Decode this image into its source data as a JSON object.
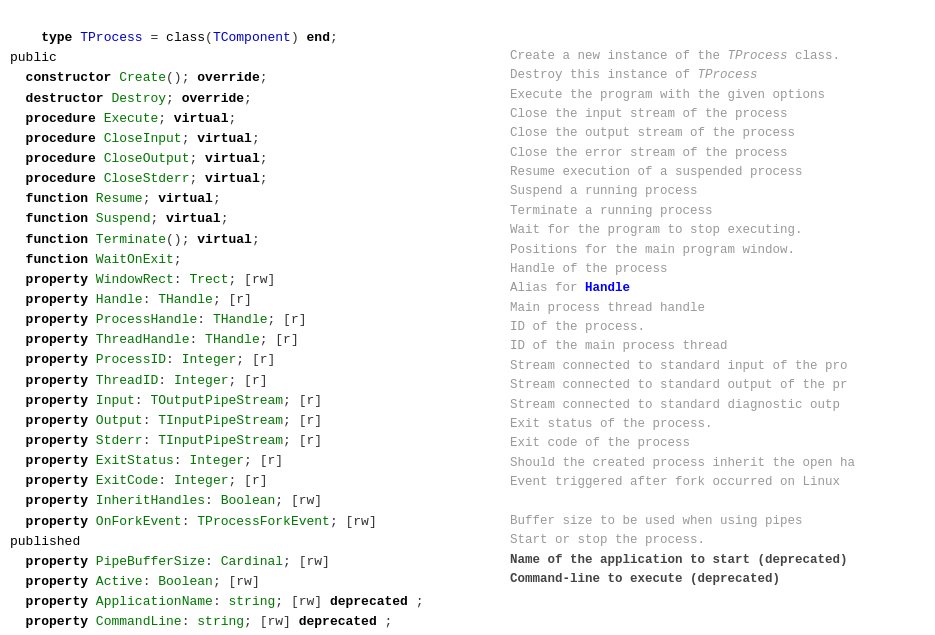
{
  "lines": [
    {
      "code": "type TProcess = class(TComponent) end;",
      "comment": ""
    },
    {
      "code": "public",
      "comment": ""
    },
    {
      "code": "  constructor Create(); override;",
      "comment": "Create a new instance of the TProcess class."
    },
    {
      "code": "  destructor Destroy; override;",
      "comment": "Destroy this instance of TProcess"
    },
    {
      "code": "  procedure Execute; virtual;",
      "comment": "Execute the program with the given options"
    },
    {
      "code": "  procedure CloseInput; virtual;",
      "comment": "Close the input stream of the process"
    },
    {
      "code": "  procedure CloseOutput; virtual;",
      "comment": "Close the output stream of the process"
    },
    {
      "code": "  procedure CloseStderr; virtual;",
      "comment": "Close the error stream of the process"
    },
    {
      "code": "  function Resume; virtual;",
      "comment": "Resume execution of a suspended process"
    },
    {
      "code": "  function Suspend; virtual;",
      "comment": "Suspend a running process"
    },
    {
      "code": "  function Terminate(); virtual;",
      "comment": "Terminate a running process"
    },
    {
      "code": "  function WaitOnExit;",
      "comment": "Wait for the program to stop executing."
    },
    {
      "code": "  property WindowRect: Trect; [rw]",
      "comment": "Positions for the main program window."
    },
    {
      "code": "  property Handle: THandle; [r]",
      "comment": "Handle of the process"
    },
    {
      "code": "  property ProcessHandle: THandle; [r]",
      "comment": "Alias for Handle"
    },
    {
      "code": "  property ThreadHandle: THandle; [r]",
      "comment": "Main process thread handle"
    },
    {
      "code": "  property ProcessID: Integer; [r]",
      "comment": "ID of the process."
    },
    {
      "code": "  property ThreadID: Integer; [r]",
      "comment": "ID of the main process thread"
    },
    {
      "code": "  property Input: TOutputPipeStream; [r]",
      "comment": "Stream connected to standard input of the pro"
    },
    {
      "code": "  property Output: TInputPipeStream; [r]",
      "comment": "Stream connected to standard output of the pr"
    },
    {
      "code": "  property Stderr: TInputPipeStream; [r]",
      "comment": "Stream connected to standard diagnostic outp"
    },
    {
      "code": "  property ExitStatus: Integer; [r]",
      "comment": "Exit status of the process."
    },
    {
      "code": "  property ExitCode: Integer; [r]",
      "comment": "Exit code of the process"
    },
    {
      "code": "  property InheritHandles: Boolean; [rw]",
      "comment": "Should the created process inherit the open ha"
    },
    {
      "code": "  property OnForkEvent: TProcessForkEvent; [rw]",
      "comment": "Event triggered after fork occurred on Linux"
    },
    {
      "code": "published",
      "comment": ""
    },
    {
      "code": "  property PipeBufferSize: Cardinal; [rw]",
      "comment": "Buffer size to be used when using pipes"
    },
    {
      "code": "  property Active: Boolean; [rw]",
      "comment": "Start or stop the process."
    },
    {
      "code": "  property ApplicationName: string; [rw] deprecated ;",
      "comment": "Name of the application to start (deprecated)",
      "bold_comment": true
    },
    {
      "code": "  property CommandLine: string; [rw] deprecated ;",
      "comment": "Command-line to execute (deprecated)",
      "bold_comment": true
    }
  ]
}
